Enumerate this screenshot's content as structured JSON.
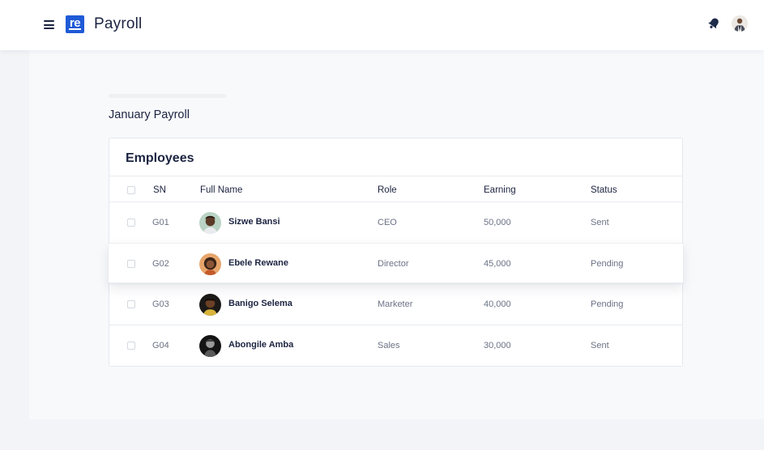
{
  "header": {
    "logo_text": "re",
    "app_title": "Payroll"
  },
  "page": {
    "title": "January Payroll"
  },
  "employees_card": {
    "title": "Employees",
    "columns": [
      "SN",
      "Full Name",
      "Role",
      "Earning",
      "Status"
    ],
    "rows": [
      {
        "sn": "G01",
        "name": "Sizwe Bansi",
        "role": "CEO",
        "earning": "50,000",
        "status": "Sent"
      },
      {
        "sn": "G02",
        "name": "Ebele Rewane",
        "role": "Director",
        "earning": "45,000",
        "status": "Pending"
      },
      {
        "sn": "G03",
        "name": "Banigo Selema",
        "role": "Marketer",
        "earning": "40,000",
        "status": "Pending"
      },
      {
        "sn": "G04",
        "name": "Abongile Amba",
        "role": "Sales",
        "earning": "30,000",
        "status": "Sent"
      }
    ]
  },
  "icons": {
    "menu": "hamburger-menu-icon",
    "notifications": "bell-icon",
    "profile": "user-avatar"
  },
  "colors": {
    "brand": "#1f5ad6",
    "text_dark": "#1b2340",
    "text_muted": "#6b7285"
  }
}
